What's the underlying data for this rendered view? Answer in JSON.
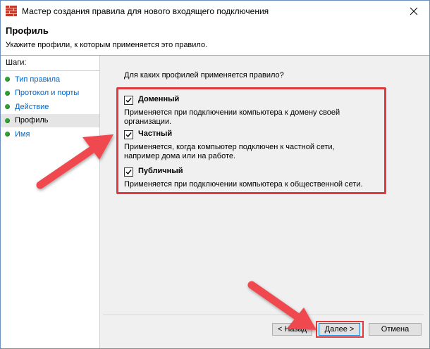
{
  "window": {
    "title": "Мастер создания правила для нового входящего подключения"
  },
  "header": {
    "title": "Профиль",
    "subtitle": "Укажите профили, к которым применяется это правило."
  },
  "sidebar": {
    "heading": "Шаги:",
    "items": [
      {
        "label": "Тип правила"
      },
      {
        "label": "Протокол и порты"
      },
      {
        "label": "Действие"
      },
      {
        "label": "Профиль"
      },
      {
        "label": "Имя"
      }
    ]
  },
  "main": {
    "question": "Для каких профилей применяется правило?",
    "options": [
      {
        "label": "Доменный",
        "checked": true,
        "description": "Применяется при подключении компьютера к домену своей организации."
      },
      {
        "label": "Частный",
        "checked": true,
        "description": "Применяется, когда компьютер подключен к частной сети, например дома или на работе."
      },
      {
        "label": "Публичный",
        "checked": true,
        "description": "Применяется при подключении компьютера к общественной сети."
      }
    ]
  },
  "buttons": {
    "back": "< Назад",
    "next": "Далее >",
    "cancel": "Отмена"
  },
  "colors": {
    "highlight": "#e0393e",
    "step_dot": "#2fa52f",
    "link": "#0066cc"
  }
}
